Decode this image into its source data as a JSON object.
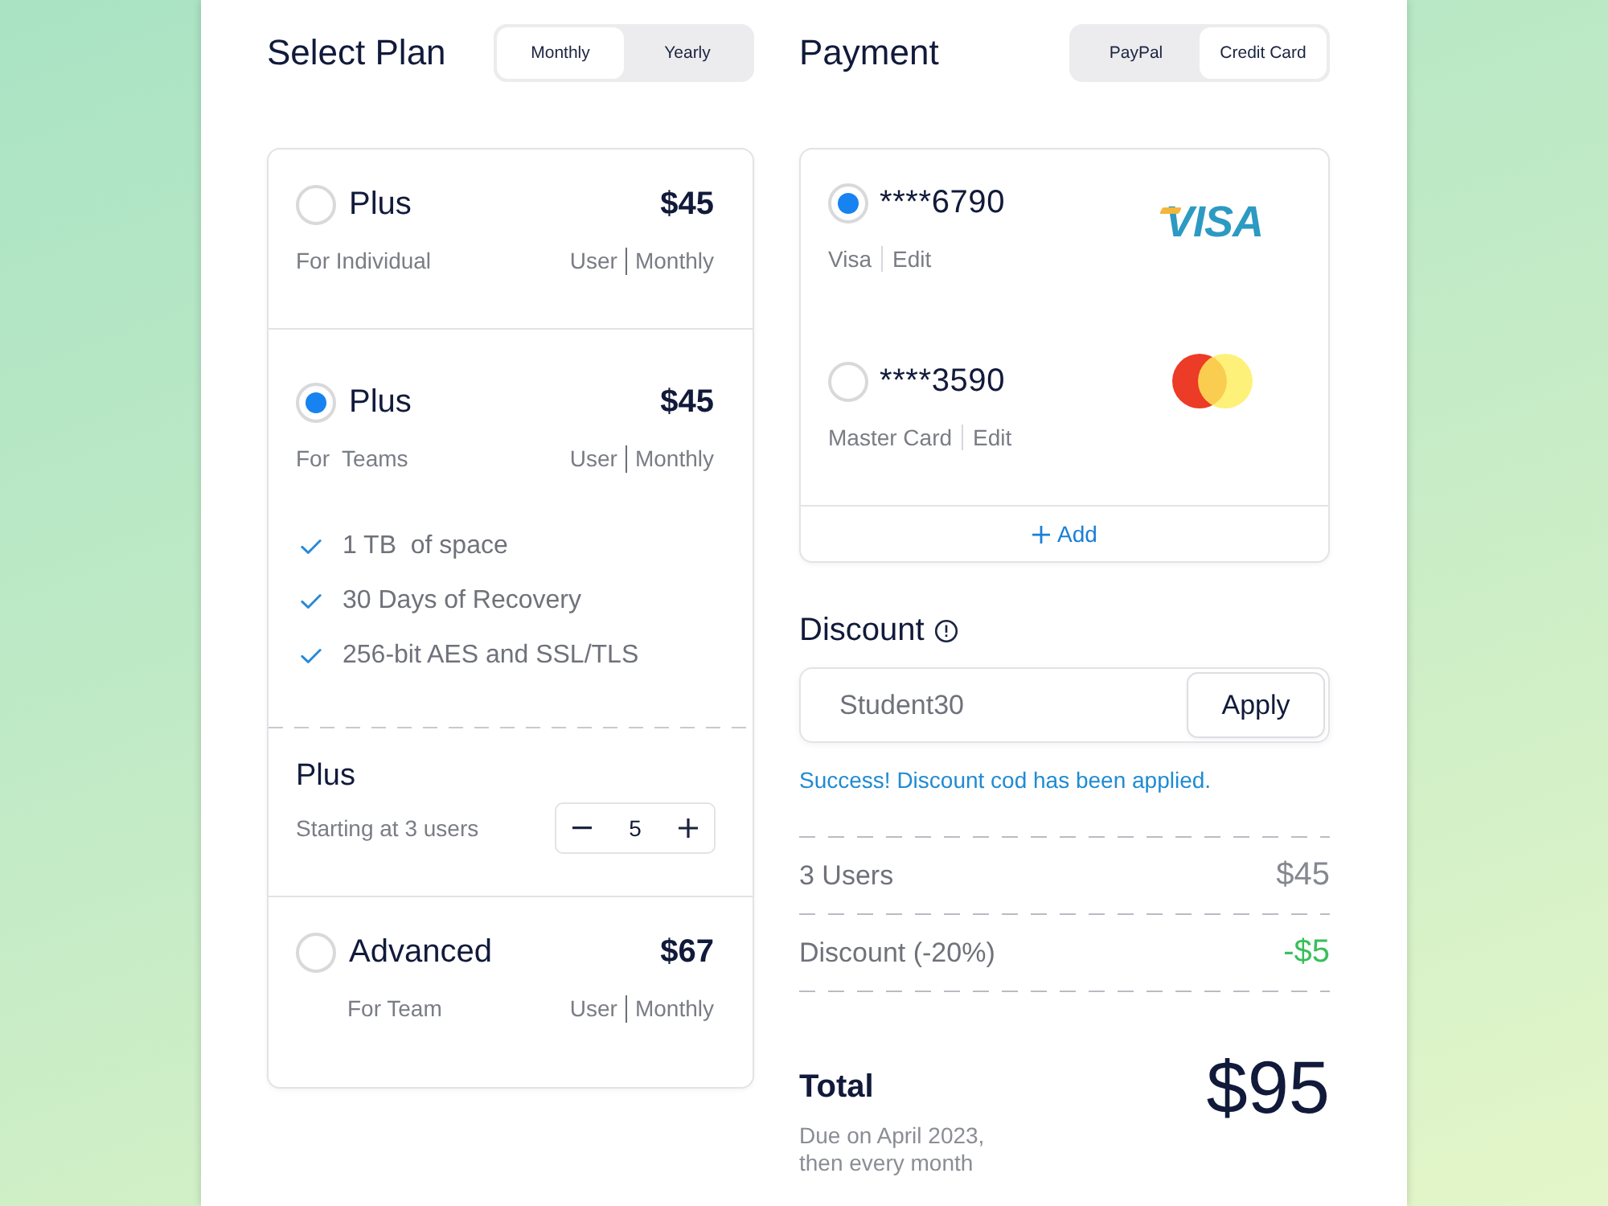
{
  "plan_panel": {
    "title": "Select Plan",
    "billing_tabs": [
      {
        "label": "Monthly",
        "selected": true
      },
      {
        "label": "Yearly",
        "selected": false
      }
    ],
    "plans": [
      {
        "name": "Plus",
        "price": "$45",
        "audience": "For Individual",
        "unit": "User",
        "period": "Monthly",
        "selected": false
      },
      {
        "name": "Plus",
        "price": "$45",
        "audience": "For  Teams",
        "unit": "User",
        "period": "Monthly",
        "selected": true,
        "features": [
          "1 TB  of space",
          "30 Days of Recovery",
          "256-bit AES and SSL/TLS"
        ],
        "seats": {
          "name": "Plus",
          "note": "Starting at 3 users",
          "quantity": "5"
        }
      },
      {
        "name": "Advanced",
        "price": "$67",
        "audience": "For Team",
        "unit": "User",
        "period": "Monthly",
        "selected": false
      }
    ]
  },
  "payment": {
    "title": "Payment",
    "method_tabs": [
      {
        "label": "PayPal",
        "selected": false
      },
      {
        "label": "Credit Card",
        "selected": true
      }
    ],
    "cards": [
      {
        "number": "****6790",
        "brand": "Visa",
        "action": "Edit",
        "logo": {
          "kind": "visa",
          "text": "VISA"
        },
        "selected": true
      },
      {
        "number": "****3590",
        "brand": "Master Card",
        "action": "Edit",
        "logo": {
          "kind": "mastercard"
        },
        "selected": false
      }
    ],
    "add_label": "Add"
  },
  "discount": {
    "title": "Discount",
    "code_field": {
      "value": "Student30"
    },
    "apply_label": "Apply",
    "message": "Success! Discount cod has been applied."
  },
  "summary": {
    "lines": [
      {
        "label": "3 Users",
        "amount": "$45",
        "kind": "charge"
      },
      {
        "label": "Discount (-20%)",
        "amount": "-$5",
        "kind": "discount"
      }
    ],
    "total": {
      "label": "Total",
      "amount": "$95",
      "note": "Due on April 2023, then every month"
    }
  }
}
